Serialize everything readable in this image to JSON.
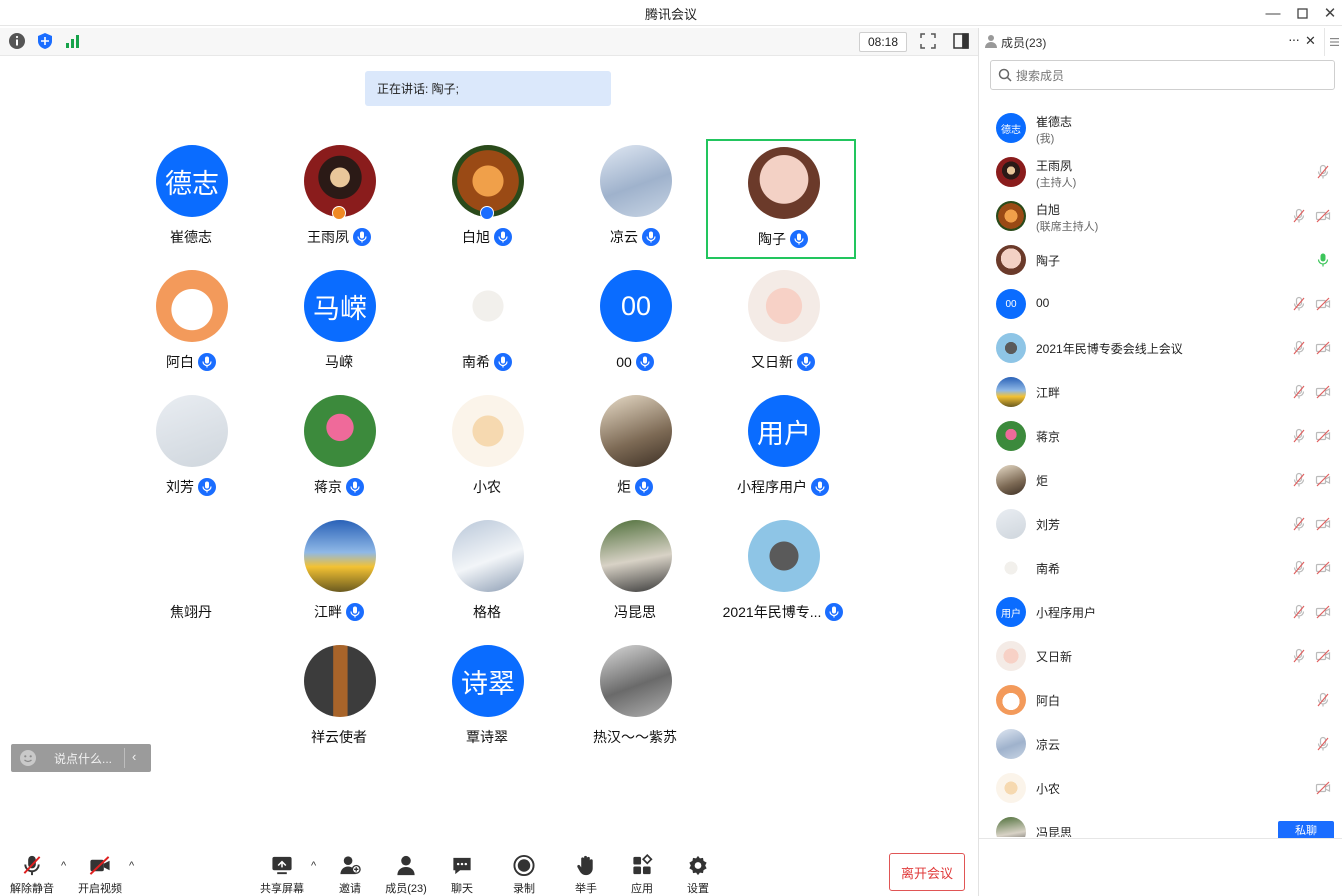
{
  "window": {
    "title": "腾讯会议"
  },
  "toolbar": {
    "timer": "08:18"
  },
  "speaking": {
    "text": "正在讲话: 陶子;"
  },
  "grid": [
    {
      "name": "崔德志",
      "avatar_text": "德志",
      "mic": false
    },
    {
      "name": "王雨夙",
      "avatar_text": "",
      "mic": true,
      "badge": "host"
    },
    {
      "name": "白旭",
      "avatar_text": "",
      "mic": true,
      "badge": "cohost"
    },
    {
      "name": "凉云",
      "avatar_text": "",
      "mic": true
    },
    {
      "name": "陶子",
      "avatar_text": "",
      "mic": true,
      "active": true
    },
    {
      "name": "阿白",
      "avatar_text": "",
      "mic": true
    },
    {
      "name": "马嵘",
      "avatar_text": "马嵘",
      "mic": false
    },
    {
      "name": "南希",
      "avatar_text": "",
      "mic": true
    },
    {
      "name": "00",
      "avatar_text": "00",
      "mic": true
    },
    {
      "name": "又日新",
      "avatar_text": "",
      "mic": true
    },
    {
      "name": "刘芳",
      "avatar_text": "",
      "mic": true
    },
    {
      "name": "蒋京",
      "avatar_text": "",
      "mic": true
    },
    {
      "name": "小农",
      "avatar_text": "",
      "mic": false
    },
    {
      "name": "炬",
      "avatar_text": "",
      "mic": true
    },
    {
      "name": "小程序用户",
      "avatar_text": "用户",
      "mic": true
    },
    {
      "name": "焦翊丹",
      "avatar_text": "",
      "mic": false
    },
    {
      "name": "江畔",
      "avatar_text": "",
      "mic": true
    },
    {
      "name": "格格",
      "avatar_text": "",
      "mic": false
    },
    {
      "name": "冯昆思",
      "avatar_text": "",
      "mic": false
    },
    {
      "name": "2021年民博专...",
      "avatar_text": "",
      "mic": true
    },
    {
      "name": "祥云使者",
      "avatar_text": "",
      "mic": false
    },
    {
      "name": "覃诗翠",
      "avatar_text": "诗翠",
      "mic": false
    },
    {
      "name": "热汉～～紫苏",
      "avatar_text": "",
      "mic": false
    }
  ],
  "chat": {
    "placeholder": "说点什么..."
  },
  "bottom": {
    "unmute": "解除静音",
    "video": "开启视频",
    "share": "共享屏幕",
    "invite": "邀请",
    "members": "成员(23)",
    "chat": "聊天",
    "record": "录制",
    "raise_hand": "举手",
    "apps": "应用",
    "settings": "设置",
    "leave": "离开会议"
  },
  "panel": {
    "title": "成员(23)",
    "search_placeholder": "搜索成员",
    "private_chat": "私聊",
    "members": [
      {
        "name": "崔德志",
        "sub": "(我)",
        "avatar_text": "德志",
        "mic": "none",
        "cam": "none"
      },
      {
        "name": "王雨夙",
        "sub": "(主持人)",
        "avatar_text": "",
        "mic": "off",
        "cam": "none"
      },
      {
        "name": "白旭",
        "sub": "(联席主持人)",
        "avatar_text": "",
        "mic": "off",
        "cam": "off"
      },
      {
        "name": "陶子",
        "sub": "",
        "avatar_text": "",
        "mic": "on",
        "cam": "none"
      },
      {
        "name": "00",
        "sub": "",
        "avatar_text": "00",
        "mic": "off",
        "cam": "off"
      },
      {
        "name": "2021年民博专委会线上会议",
        "sub": "",
        "avatar_text": "",
        "mic": "off",
        "cam": "off"
      },
      {
        "name": "江畔",
        "sub": "",
        "avatar_text": "",
        "mic": "off",
        "cam": "off"
      },
      {
        "name": "蒋京",
        "sub": "",
        "avatar_text": "",
        "mic": "off",
        "cam": "off"
      },
      {
        "name": "炬",
        "sub": "",
        "avatar_text": "",
        "mic": "off",
        "cam": "off"
      },
      {
        "name": "刘芳",
        "sub": "",
        "avatar_text": "",
        "mic": "off",
        "cam": "off"
      },
      {
        "name": "南希",
        "sub": "",
        "avatar_text": "",
        "mic": "off",
        "cam": "off"
      },
      {
        "name": "小程序用户",
        "sub": "",
        "avatar_text": "用户",
        "mic": "off",
        "cam": "off"
      },
      {
        "name": "又日新",
        "sub": "",
        "avatar_text": "",
        "mic": "off",
        "cam": "off"
      },
      {
        "name": "阿白",
        "sub": "",
        "avatar_text": "",
        "mic": "off",
        "cam": "none"
      },
      {
        "name": "凉云",
        "sub": "",
        "avatar_text": "",
        "mic": "off",
        "cam": "none"
      },
      {
        "name": "小农",
        "sub": "",
        "avatar_text": "",
        "mic": "none",
        "cam": "off"
      },
      {
        "name": "冯昆思",
        "sub": "",
        "avatar_text": "",
        "mic": "none",
        "cam": "none"
      }
    ]
  },
  "colors": {
    "accent": "#0a6cff",
    "active_border": "#22c55e",
    "leave": "#e03a3a"
  }
}
